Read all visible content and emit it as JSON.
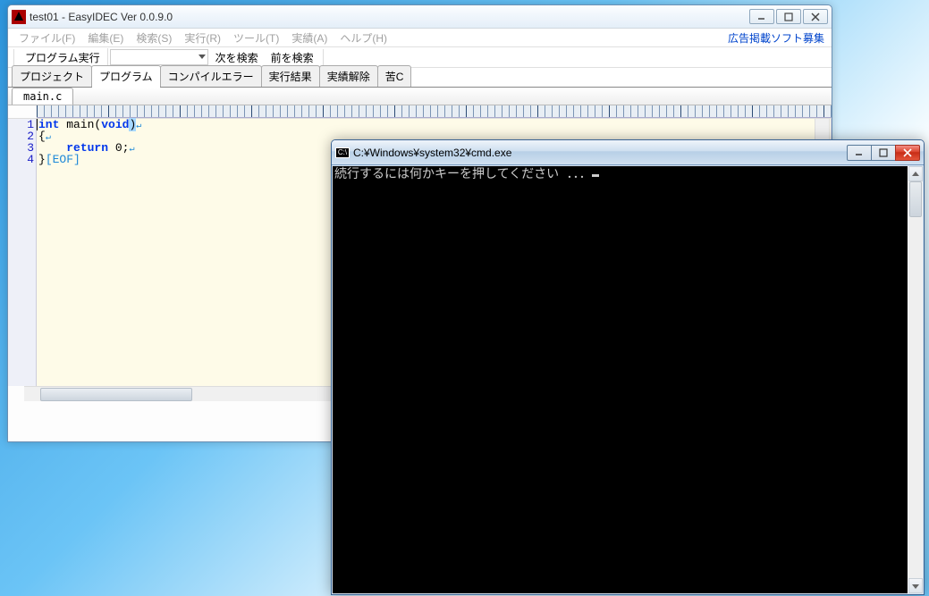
{
  "ide": {
    "title": "test01 - EasyIDEC Ver 0.0.9.0",
    "menu": {
      "file": "ファイル(F)",
      "edit": "編集(E)",
      "search": "検索(S)",
      "run": "実行(R)",
      "tool": "ツール(T)",
      "result": "実績(A)",
      "help": "ヘルプ(H)"
    },
    "ad_link": "広告掲載ソフト募集",
    "toolbar": {
      "run_label": "プログラム実行",
      "next_search": "次を検索",
      "prev_search": "前を検索"
    },
    "tabs": {
      "project": "プロジェクト",
      "program": "プログラム",
      "compile_error": "コンパイルエラー",
      "exec_result": "実行結果",
      "result_unlock": "実績解除",
      "kurushic": "苦C"
    },
    "file_tab": "main.c",
    "code": {
      "line1_kw1": "int",
      "line1_fn": " main",
      "line1_rest1": "(",
      "line1_kw2": "void",
      "line1_rest2": ")",
      "line2": "{",
      "line3_indent": "    ",
      "line3_kw": "return",
      "line3_rest": " 0;",
      "line4_a": "}",
      "line4_eof": "[EOF]",
      "eol_mark": "↵"
    },
    "line_numbers": [
      "1",
      "2",
      "3",
      "4"
    ]
  },
  "cmd": {
    "title": "C:¥Windows¥system32¥cmd.exe",
    "output": "続行するには何かキーを押してください ．．．",
    "icon_label": "C:\\"
  }
}
